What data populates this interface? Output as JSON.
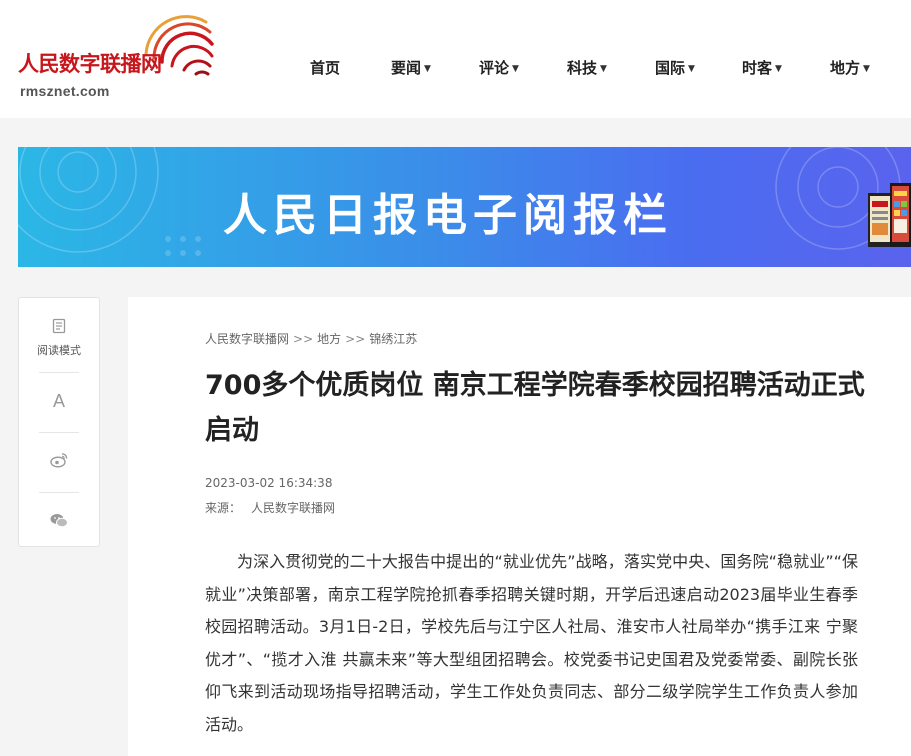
{
  "header": {
    "logo_title": "人民数字联播网",
    "logo_domain": "rmsznet.com",
    "brand_color": "#c8161d"
  },
  "nav": {
    "items": [
      {
        "label": "首页",
        "dropdown": false
      },
      {
        "label": "要闻",
        "dropdown": true
      },
      {
        "label": "评论",
        "dropdown": true
      },
      {
        "label": "科技",
        "dropdown": true
      },
      {
        "label": "国际",
        "dropdown": true
      },
      {
        "label": "时客",
        "dropdown": true
      },
      {
        "label": "地方",
        "dropdown": true
      }
    ]
  },
  "banner": {
    "title": "人民日报电子阅报栏"
  },
  "tools": {
    "reading_mode_label": "阅读模式",
    "font_size_glyph": "A",
    "icons": [
      "reading-mode-icon",
      "font-size-icon",
      "weibo-icon",
      "wechat-icon"
    ]
  },
  "article": {
    "breadcrumb": [
      "人民数字联播网",
      "地方",
      "锦绣江苏"
    ],
    "breadcrumb_separator": ">>",
    "title": "700多个优质岗位 南京工程学院春季校园招聘活动正式启动",
    "datetime": "2023-03-02 16:34:38",
    "source_label": "来源：",
    "source_name": "人民数字联播网",
    "paragraph": "为深入贯彻党的二十大报告中提出的“就业优先”战略，落实党中央、国务院“稳就业”“保就业”决策部署，南京工程学院抢抓春季招聘关键时期，开学后迅速启动2023届毕业生春季校园招聘活动。3月1日-2日，学校先后与江宁区人社局、淮安市人社局举办“携手江来 宁聚优才”、“揽才入淮 共赢未来”等大型组团招聘会。校党委书记史国君及党委常委、副院长张仰飞来到活动现场指导招聘活动，学生工作处负责同志、部分二级学院学生工作负责人参加活动。"
  }
}
